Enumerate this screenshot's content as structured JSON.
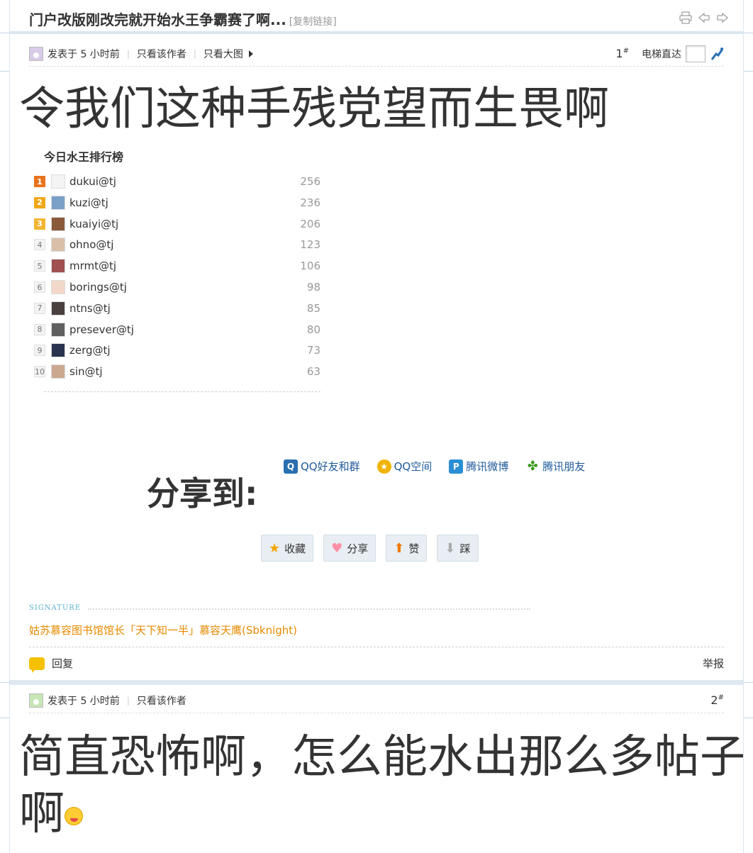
{
  "thread": {
    "title": "门户改版刚改完就开始水王争霸赛了啊...",
    "copy_link": "[复制链接]"
  },
  "posts": [
    {
      "posted": "发表于 5 小时前",
      "only_author": "只看该作者",
      "only_images": "只看大图",
      "floor": "1",
      "floor_mark": "#",
      "goto_label": "电梯直达",
      "text": "令我们这种手残党望而生畏啊"
    },
    {
      "posted": "发表于 5 小时前",
      "only_author": "只看该作者",
      "floor": "2",
      "floor_mark": "#",
      "text_line1": "简直恐怖啊，怎么能水出那么多帖子",
      "text_line2": "啊"
    }
  ],
  "ranking": {
    "title": "今日水王排行榜",
    "rows": [
      {
        "rank": "1",
        "name": "dukui@tj",
        "value": "256"
      },
      {
        "rank": "2",
        "name": "kuzi@tj",
        "value": "236"
      },
      {
        "rank": "3",
        "name": "kuaiyi@tj",
        "value": "206"
      },
      {
        "rank": "4",
        "name": "ohno@tj",
        "value": "123"
      },
      {
        "rank": "5",
        "name": "mrmt@tj",
        "value": "106"
      },
      {
        "rank": "6",
        "name": "borings@tj",
        "value": "98"
      },
      {
        "rank": "7",
        "name": "ntns@tj",
        "value": "85"
      },
      {
        "rank": "8",
        "name": "presever@tj",
        "value": "80"
      },
      {
        "rank": "9",
        "name": "zerg@tj",
        "value": "73"
      },
      {
        "rank": "10",
        "name": "sin@tj",
        "value": "63"
      }
    ]
  },
  "share": {
    "label": "分享到:",
    "links": [
      "QQ好友和群",
      "QQ空间",
      "腾讯微博",
      "腾讯朋友"
    ]
  },
  "actions": {
    "favorite": "收藏",
    "share": "分享",
    "like": "赞",
    "dislike": "踩"
  },
  "signature": {
    "label": "SIGNATURE",
    "text": "姑苏慕容图书馆馆长「天下知一半」慕容天鹰(Sbknight)"
  },
  "footer": {
    "reply": "回复",
    "report": "举报"
  },
  "colors": {
    "accent_blue": "#1f5a9a",
    "signature_orange": "#e58a00",
    "divider": "#dfe8f0"
  }
}
